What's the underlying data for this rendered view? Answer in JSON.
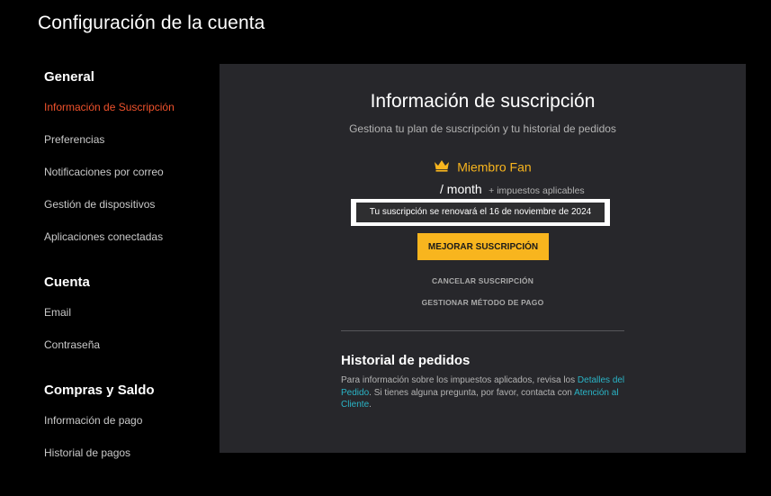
{
  "page": {
    "title": "Configuración de la cuenta"
  },
  "sidebar": {
    "sections": [
      {
        "title": "General",
        "items": [
          {
            "label": "Información de Suscripción",
            "active": true
          },
          {
            "label": "Preferencias"
          },
          {
            "label": "Notificaciones por correo"
          },
          {
            "label": "Gestión de dispositivos"
          },
          {
            "label": "Aplicaciones conectadas"
          }
        ]
      },
      {
        "title": "Cuenta",
        "items": [
          {
            "label": "Email"
          },
          {
            "label": "Contraseña"
          }
        ]
      },
      {
        "title": "Compras y Saldo",
        "items": [
          {
            "label": "Información de pago"
          },
          {
            "label": "Historial de pagos"
          }
        ]
      }
    ]
  },
  "subscription": {
    "title": "Información de suscripción",
    "subtitle": "Gestiona tu plan de suscripción y tu historial de pedidos",
    "plan_icon": "crown-icon",
    "plan_name": "Miembro Fan",
    "price_period": "/ month",
    "price_tax": "+ impuestos aplicables",
    "renewal_text": "Tu suscripción se renovará el 16 de noviembre de 2024",
    "upgrade_label": "MEJORAR SUSCRIPCIÓN",
    "cancel_label": "CANCELAR SUSCRIPCIÓN",
    "manage_payment_label": "GESTIONAR MÉTODO DE PAGO"
  },
  "order_history": {
    "title": "Historial de pedidos",
    "text_1": "Para información sobre los impuestos aplicados, revisa los ",
    "link_details": "Detalles del Pedido",
    "text_2": ". Si tienes alguna pregunta, por favor, contacta con ",
    "link_support": "Atención al Cliente",
    "text_3": "."
  },
  "colors": {
    "background": "#000000",
    "panel": "#27272b",
    "accent_orange": "#f0522c",
    "accent_gold": "#f8b51e",
    "link": "#2ab4c6"
  }
}
